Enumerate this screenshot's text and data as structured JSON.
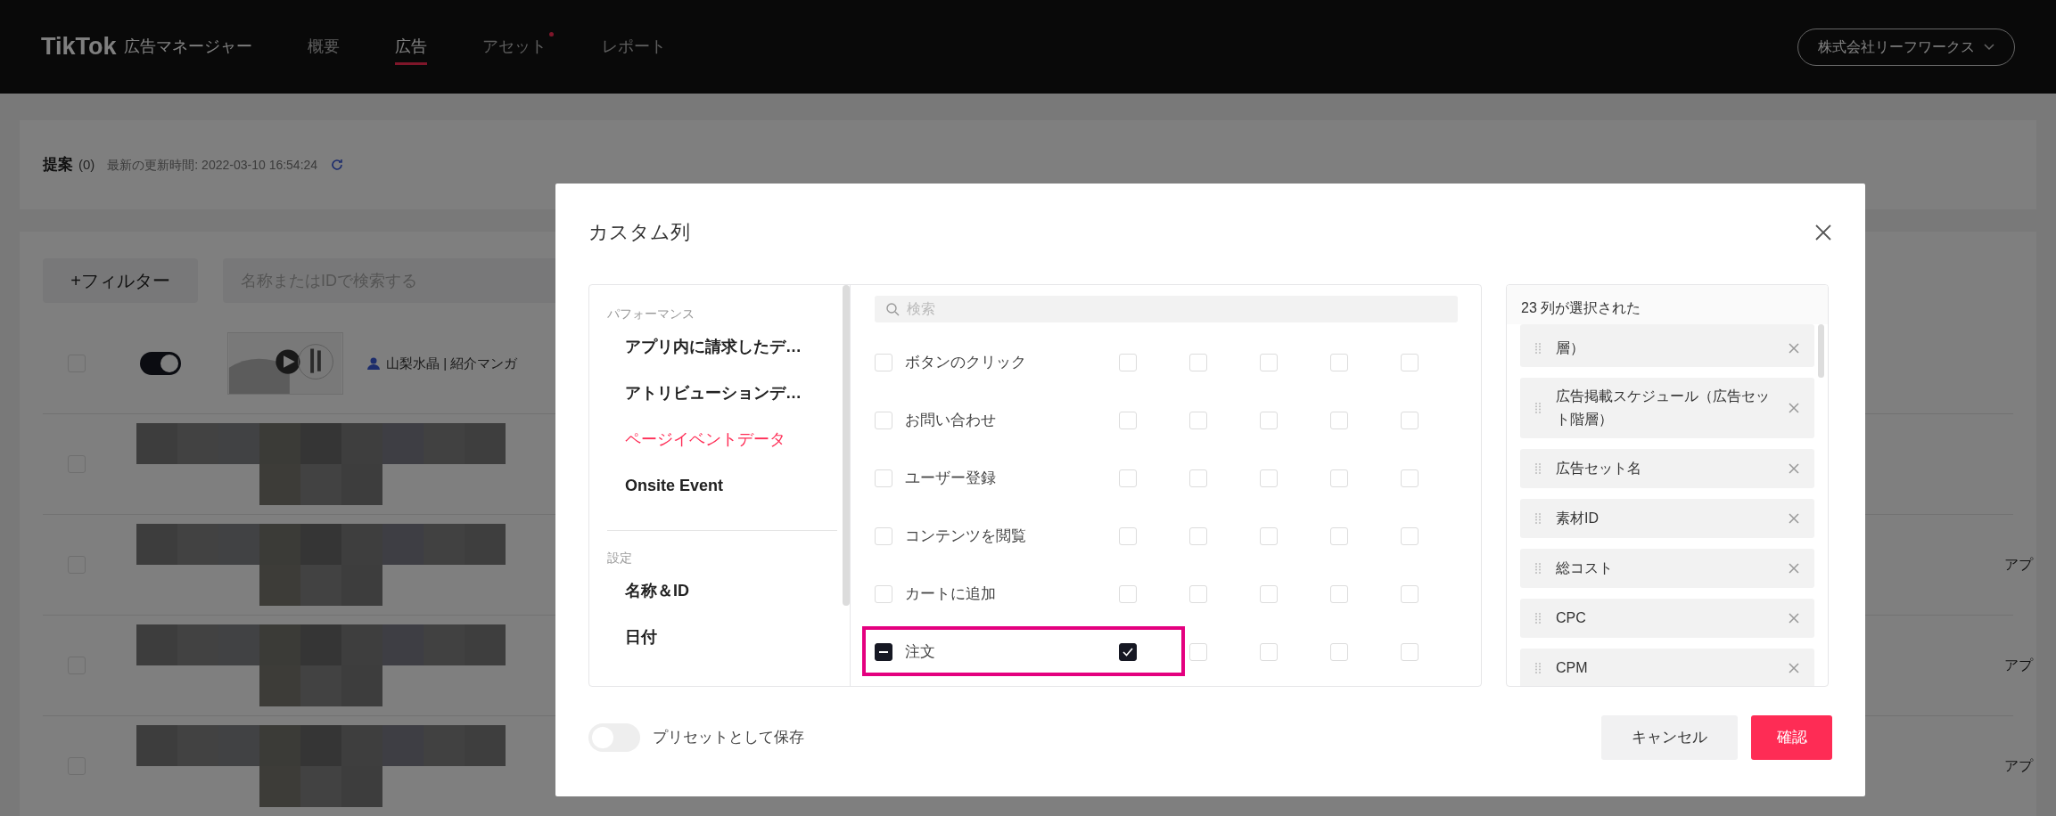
{
  "header": {
    "logo": "TikTok",
    "product": "広告マネージャー",
    "nav": [
      {
        "label": "概要",
        "selected": false,
        "badge": false
      },
      {
        "label": "広告",
        "selected": true,
        "badge": false
      },
      {
        "label": "アセット",
        "selected": false,
        "badge": true
      },
      {
        "label": "レポート",
        "selected": false,
        "badge": false
      }
    ],
    "account": "株式会社リーフワークス"
  },
  "page": {
    "summary_title": "提案",
    "summary_count": "(0)",
    "updated": "最新の更新時間: 2022-03-10 16:54:24",
    "filter_button": "+フィルター",
    "search_placeholder": "名称またはIDで検索する",
    "rows": [
      {
        "kind": "ad",
        "checked": false,
        "on": true,
        "name": "山梨水晶 | 紹介マンガ"
      },
      {
        "kind": "redacted",
        "checked": false
      },
      {
        "kind": "redacted",
        "checked": false,
        "tail": "アプ"
      },
      {
        "kind": "redacted",
        "checked": false,
        "tail": "アプ"
      },
      {
        "kind": "redacted",
        "checked": false,
        "tail": "アプ"
      }
    ]
  },
  "modal": {
    "title": "カスタム列",
    "category_groups": [
      {
        "heading": "パフォーマンス",
        "items": [
          {
            "label": "アプリ内に請求したデ…",
            "selected": false
          },
          {
            "label": "アトリビューションデ…",
            "selected": false
          },
          {
            "label": "ページイベントデータ",
            "selected": true
          },
          {
            "label": "Onsite Event",
            "selected": false
          }
        ]
      },
      {
        "heading": "設定",
        "items": [
          {
            "label": "名称＆ID",
            "selected": false
          },
          {
            "label": "日付",
            "selected": false
          }
        ]
      }
    ],
    "search_placeholder": "検索",
    "metrics": [
      {
        "label": "ボタンのクリック",
        "partial": false,
        "highlighted": false,
        "options": [
          {
            "checked": false
          },
          {
            "checked": false
          },
          {
            "checked": false
          },
          {
            "checked": false
          },
          {
            "checked": false
          }
        ]
      },
      {
        "label": "お問い合わせ",
        "partial": false,
        "highlighted": false,
        "options": [
          {
            "checked": false
          },
          {
            "checked": false
          },
          {
            "checked": false
          },
          {
            "checked": false
          },
          {
            "checked": false
          }
        ]
      },
      {
        "label": "ユーザー登録",
        "partial": false,
        "highlighted": false,
        "options": [
          {
            "checked": false
          },
          {
            "checked": false
          },
          {
            "checked": false
          },
          {
            "checked": false
          },
          {
            "checked": false
          }
        ]
      },
      {
        "label": "コンテンツを閲覧",
        "partial": false,
        "highlighted": false,
        "options": [
          {
            "checked": false
          },
          {
            "checked": false
          },
          {
            "checked": false
          },
          {
            "checked": false
          },
          {
            "checked": false
          }
        ]
      },
      {
        "label": "カートに追加",
        "partial": false,
        "highlighted": false,
        "options": [
          {
            "checked": false
          },
          {
            "checked": false
          },
          {
            "checked": false
          },
          {
            "checked": false
          },
          {
            "checked": false
          }
        ]
      },
      {
        "label": "注文",
        "partial": true,
        "highlighted": true,
        "options": [
          {
            "checked": true
          },
          {
            "checked": false
          },
          {
            "checked": false
          },
          {
            "checked": false
          },
          {
            "checked": false
          }
        ]
      }
    ],
    "selected_header": "23 列が選択された",
    "selected_columns": [
      "層）",
      "広告掲載スケジュール（広告セット階層）",
      "広告セット名",
      "素材ID",
      "総コスト",
      "CPC",
      "CPM"
    ],
    "preset": {
      "label": "プリセットとして保存",
      "on": false
    },
    "cancel": "キャンセル",
    "confirm": "確認"
  }
}
